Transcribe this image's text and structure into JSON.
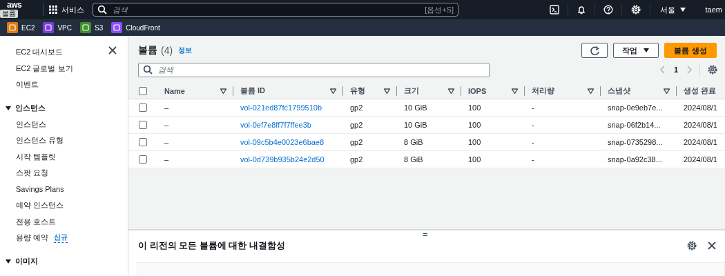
{
  "top_bar": {
    "logo": "aws",
    "tooltip": "볼륨",
    "services": "서비스",
    "search": {
      "placeholder": "검색",
      "shortcut": "[옵션+S]"
    },
    "region": "서울",
    "user": "taem"
  },
  "favorites": [
    {
      "label": "EC2",
      "color": "#e07b12"
    },
    {
      "label": "VPC",
      "color": "#7d3ddb"
    },
    {
      "label": "S3",
      "color": "#3f8f2a"
    },
    {
      "label": "CloudFront",
      "color": "#8c4fff"
    }
  ],
  "sidebar": {
    "items": [
      {
        "label": "EC2 대시보드",
        "kind": "link"
      },
      {
        "label": "EC2 글로벌 보기",
        "kind": "link"
      },
      {
        "label": "이벤트",
        "kind": "link"
      },
      {
        "label": "인스턴스",
        "kind": "section",
        "expanded": true,
        "children": [
          {
            "label": "인스턴스"
          },
          {
            "label": "인스턴스 유형"
          },
          {
            "label": "시작 템플릿"
          },
          {
            "label": "스팟 요청"
          },
          {
            "label": "Savings Plans"
          },
          {
            "label": "예약 인스턴스"
          },
          {
            "label": "전용 호스트"
          },
          {
            "label": "용량 예약",
            "badge": "신규"
          }
        ]
      },
      {
        "label": "이미지",
        "kind": "section",
        "expanded": true
      }
    ]
  },
  "volumes": {
    "title": "볼륨",
    "count": "(4)",
    "info": "정보",
    "actions": "작업",
    "create": "볼륨 생성",
    "search": {
      "placeholder": "검색"
    },
    "page": "1",
    "columns": [
      "Name",
      "볼륨 ID",
      "유형",
      "크기",
      "IOPS",
      "처리량",
      "스냅샷",
      "생성 완료"
    ],
    "header_checked": false,
    "rows": [
      {
        "checked": false,
        "cells": [
          "–",
          "vol-021ed87fc1799510b",
          "gp2",
          "10 GiB",
          "100",
          "-",
          "snap-0e9eb7e...",
          "2024/08/1"
        ]
      },
      {
        "checked": false,
        "cells": [
          "–",
          "vol-0ef7e8ff7f7ffee3b",
          "gp2",
          "10 GiB",
          "100",
          "-",
          "snap-06f2b14...",
          "2024/08/1"
        ]
      },
      {
        "checked": false,
        "cells": [
          "–",
          "vol-09c5b4e0023e6bae8",
          "gp2",
          "8 GiB",
          "100",
          "-",
          "snap-0735298...",
          "2024/08/1"
        ]
      },
      {
        "checked": false,
        "cells": [
          "–",
          "vol-0d739b935b24e2d50",
          "gp2",
          "8 GiB",
          "100",
          "-",
          "snap-0a92c38...",
          "2024/08/1"
        ]
      }
    ]
  },
  "split_panel": {
    "handle": "=",
    "title": "이 리전의 모든 볼륨에 대한 내결함성"
  }
}
